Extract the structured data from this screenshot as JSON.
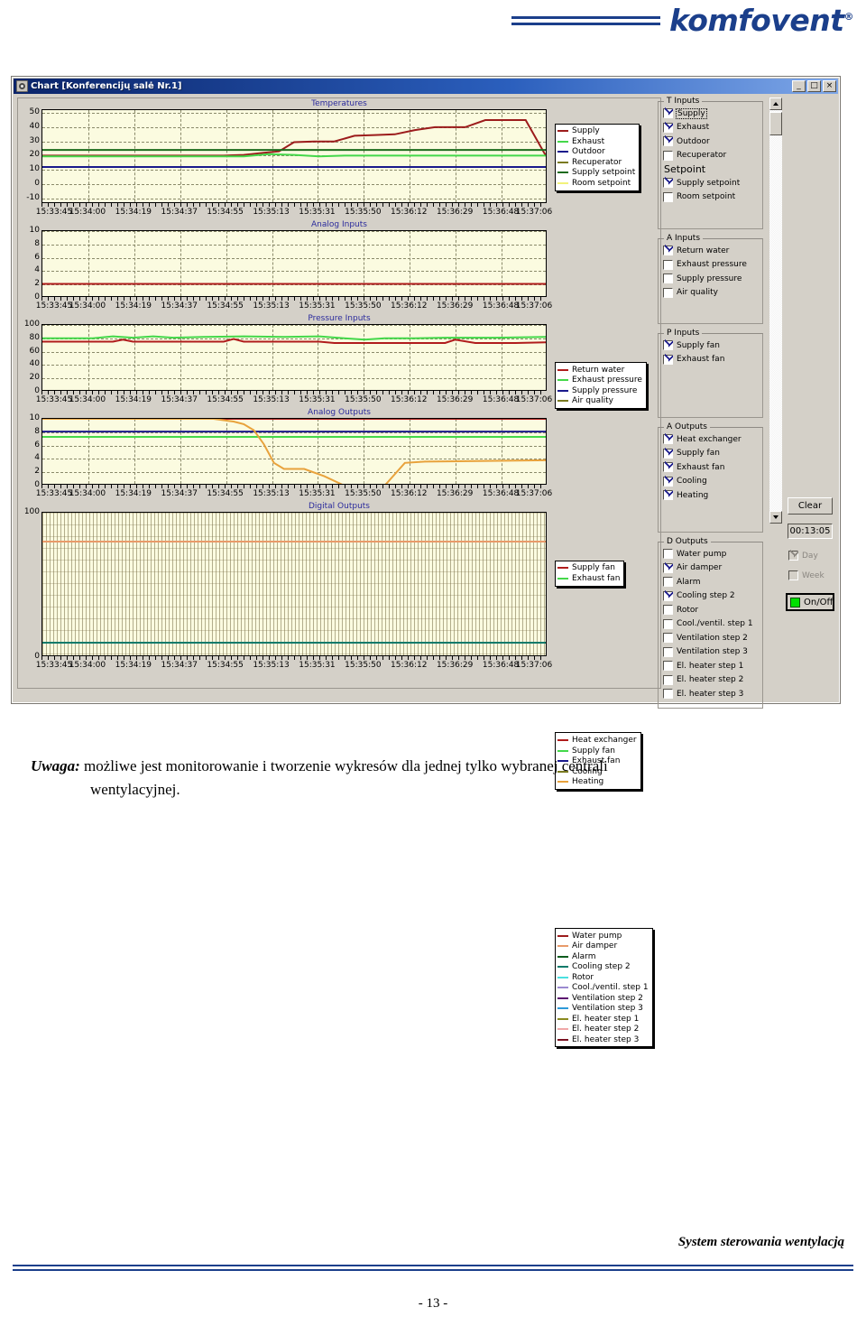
{
  "brand": {
    "name": "komfovent",
    "registered": "®"
  },
  "window": {
    "title": "Chart [Konferencijų salė Nr.1]",
    "minimize_label": "_",
    "maximize_label": "□",
    "close_label": "×"
  },
  "xaxis_labels": [
    "15:33:45",
    "15:34:00",
    "15:34:19",
    "15:34:37",
    "15:34:55",
    "15:35:13",
    "15:35:31",
    "15:35:50",
    "15:36:12",
    "15:36:29",
    "15:36:48",
    "15:37:06"
  ],
  "charts": [
    {
      "title": "Temperatures",
      "yticks": [
        "50",
        "40",
        "30",
        "20",
        "10",
        "0",
        "-10"
      ],
      "legend": [
        {
          "label": "Supply",
          "color": "#9c1c1c"
        },
        {
          "label": "Exhaust",
          "color": "#44d84a"
        },
        {
          "label": "Outdoor",
          "color": "#1a1a8c"
        },
        {
          "label": "Recuperator",
          "color": "#7a7a20"
        },
        {
          "label": "Supply setpoint",
          "color": "#1d6b1d"
        },
        {
          "label": "Room setpoint",
          "color": "#f2f27a"
        }
      ]
    },
    {
      "title": "Analog Inputs",
      "yticks": [
        "10",
        "8",
        "6",
        "4",
        "2",
        "0"
      ],
      "legend": [
        {
          "label": "Return water",
          "color": "#b01c1c"
        },
        {
          "label": "Exhaust pressure",
          "color": "#44d84a"
        },
        {
          "label": "Supply pressure",
          "color": "#1a1a8c"
        },
        {
          "label": "Air quality",
          "color": "#7a7a20"
        }
      ]
    },
    {
      "title": "Pressure Inputs",
      "yticks": [
        "100",
        "80",
        "60",
        "40",
        "20",
        "0"
      ],
      "legend": [
        {
          "label": "Supply fan",
          "color": "#b01c1c"
        },
        {
          "label": "Exhaust fan",
          "color": "#44d84a"
        }
      ]
    },
    {
      "title": "Analog Outputs",
      "yticks": [
        "10",
        "8",
        "6",
        "4",
        "2",
        "0"
      ],
      "legend": [
        {
          "label": "Heat exchanger",
          "color": "#b01c1c"
        },
        {
          "label": "Supply fan",
          "color": "#44d84a"
        },
        {
          "label": "Exhaust fan",
          "color": "#1a1a8c"
        },
        {
          "label": "Cooling",
          "color": "#7a7a20"
        },
        {
          "label": "Heating",
          "color": "#e8a23c"
        }
      ]
    },
    {
      "title": "Digital Outputs",
      "yticks": [
        "100",
        "0"
      ],
      "legend": [
        {
          "label": "Water pump",
          "color": "#9c1c1c"
        },
        {
          "label": "Air damper",
          "color": "#e89a6a"
        },
        {
          "label": "Alarm",
          "color": "#0d5c1e"
        },
        {
          "label": "Cooling step 2",
          "color": "#0d7a6a"
        },
        {
          "label": "Rotor",
          "color": "#4ae0e0"
        },
        {
          "label": "Cool./ventil. step 1",
          "color": "#9a8ad0"
        },
        {
          "label": "Ventilation step 2",
          "color": "#5c1070"
        },
        {
          "label": "Ventilation step 3",
          "color": "#2e9ad8"
        },
        {
          "label": "El. heater step 1",
          "color": "#8a8a20"
        },
        {
          "label": "El. heater step 2",
          "color": "#f0a8a8"
        },
        {
          "label": "El. heater step 3",
          "color": "#7a1020"
        }
      ]
    }
  ],
  "chart_data": {
    "type": "line",
    "title": "Chart [Konferencijų salė Nr.1]",
    "xlabel": "",
    "x_ticks": [
      "15:33:45",
      "15:34:00",
      "15:34:19",
      "15:34:37",
      "15:34:55",
      "15:35:13",
      "15:35:31",
      "15:35:50",
      "15:36:12",
      "15:36:29",
      "15:36:48",
      "15:37:06"
    ],
    "grid": true,
    "legend_position": "right",
    "panels": [
      {
        "title": "Temperatures",
        "ylabel": "",
        "ylim": [
          -14,
          52
        ],
        "yticks": [
          50,
          40,
          30,
          20,
          10,
          0,
          -10
        ],
        "series": [
          {
            "name": "Supply",
            "color": "#9c1c1c",
            "x": [
              0,
              18,
              36,
              40,
              44,
              47,
              50,
              54,
              58,
              62,
              66,
              70,
              74,
              78,
              84,
              88,
              92,
              96,
              100
            ],
            "values": [
              20,
              20,
              20,
              20.5,
              22,
              23,
              29.5,
              30,
              30,
              34,
              34.5,
              35,
              38,
              40,
              40,
              45,
              45,
              45,
              20
            ]
          },
          {
            "name": "Exhaust",
            "color": "#44d84a",
            "x": [
              0,
              40,
              45,
              50,
              55,
              60,
              100
            ],
            "values": [
              19.5,
              19.5,
              21,
              20.5,
              19.5,
              20,
              20
            ]
          },
          {
            "name": "Outdoor",
            "color": "#1a1a8c",
            "x": [
              0,
              100
            ],
            "values": [
              12,
              12
            ]
          },
          {
            "name": "Recuperator",
            "color": "#7a7a20",
            "x": [],
            "values": []
          },
          {
            "name": "Supply setpoint",
            "color": "#1d6b1d",
            "x": [
              0,
              100
            ],
            "values": [
              24,
              24
            ]
          },
          {
            "name": "Room setpoint",
            "color": "#f2f27a",
            "x": [],
            "values": []
          }
        ]
      },
      {
        "title": "Analog Inputs",
        "ylim": [
          0,
          10
        ],
        "yticks": [
          10,
          8,
          6,
          4,
          2,
          0
        ],
        "series": [
          {
            "name": "Return water",
            "color": "#b01c1c",
            "x": [
              0,
              100
            ],
            "values": [
              2.1,
              2.1
            ]
          },
          {
            "name": "Exhaust pressure",
            "color": "#44d84a",
            "x": [],
            "values": []
          },
          {
            "name": "Supply pressure",
            "color": "#1a1a8c",
            "x": [],
            "values": []
          },
          {
            "name": "Air quality",
            "color": "#7a7a20",
            "x": [],
            "values": []
          }
        ]
      },
      {
        "title": "Pressure Inputs",
        "ylim": [
          0,
          100
        ],
        "yticks": [
          100,
          80,
          60,
          40,
          20,
          0
        ],
        "series": [
          {
            "name": "Supply fan",
            "color": "#b01c1c",
            "x": [
              0,
              14,
              16,
              18,
              36,
              38,
              40,
              55,
              58,
              70,
              80,
              82,
              86,
              94,
              100
            ],
            "values": [
              75,
              75,
              78,
              75,
              75,
              79,
              75,
              75,
              73,
              73,
              73,
              78,
              73,
              73,
              74
            ]
          },
          {
            "name": "Exhaust fan",
            "color": "#44d84a",
            "x": [
              0,
              10,
              14,
              18,
              22,
              26,
              32,
              40,
              48,
              55,
              60,
              64,
              68,
              74,
              80,
              90,
              100
            ],
            "values": [
              80,
              80,
              83,
              81,
              83,
              81,
              82,
              83,
              82,
              83,
              80,
              78,
              80,
              80,
              81,
              81,
              82
            ]
          }
        ]
      },
      {
        "title": "Analog Outputs",
        "ylim": [
          0,
          10
        ],
        "yticks": [
          10,
          8,
          6,
          4,
          2,
          0
        ],
        "series": [
          {
            "name": "Heat exchanger",
            "color": "#b01c1c",
            "x": [
              0,
              100
            ],
            "values": [
              10,
              10
            ]
          },
          {
            "name": "Supply fan",
            "color": "#44d84a",
            "x": [
              0,
              100
            ],
            "values": [
              7.3,
              7.3
            ]
          },
          {
            "name": "Exhaust fan",
            "color": "#1a1a8c",
            "x": [
              0,
              100
            ],
            "values": [
              8.1,
              8.1
            ]
          },
          {
            "name": "Cooling",
            "color": "#7a7a20",
            "x": [
              0,
              100
            ],
            "values": [
              0,
              0
            ]
          },
          {
            "name": "Heating",
            "color": "#e8a23c",
            "x": [
              0,
              30,
              34,
              38,
              40,
              42,
              44,
              46,
              48,
              52,
              56,
              60,
              64,
              68,
              72,
              76,
              100
            ],
            "values": [
              10,
              10,
              10,
              9.6,
              9.2,
              8.3,
              6.2,
              3.4,
              2.5,
              2.5,
              1.4,
              0,
              0,
              0,
              3.4,
              3.6,
              3.8
            ]
          }
        ]
      },
      {
        "title": "Digital Outputs",
        "ylim": [
          0,
          100
        ],
        "yticks": [
          100,
          0
        ],
        "series": [
          {
            "name": "Water pump",
            "color": "#9c1c1c",
            "x": [],
            "values": []
          },
          {
            "name": "Air damper",
            "color": "#e89a6a",
            "x": [
              0,
              100
            ],
            "values": [
              80,
              80
            ]
          },
          {
            "name": "Alarm",
            "color": "#0d5c1e",
            "x": [],
            "values": []
          },
          {
            "name": "Cooling step 2",
            "color": "#0d7a6a",
            "x": [
              0,
              100
            ],
            "values": [
              10,
              10
            ]
          },
          {
            "name": "Rotor",
            "color": "#4ae0e0",
            "x": [],
            "values": []
          },
          {
            "name": "Cool./ventil. step 1",
            "color": "#9a8ad0",
            "x": [],
            "values": []
          },
          {
            "name": "Ventilation step 2",
            "color": "#5c1070",
            "x": [],
            "values": []
          },
          {
            "name": "Ventilation step 3",
            "color": "#2e9ad8",
            "x": [],
            "values": []
          },
          {
            "name": "El. heater step 1",
            "color": "#8a8a20",
            "x": [],
            "values": []
          },
          {
            "name": "El. heater step 2",
            "color": "#f0a8a8",
            "x": [],
            "values": []
          },
          {
            "name": "El. heater step 3",
            "color": "#7a1020",
            "x": [],
            "values": []
          }
        ]
      }
    ]
  },
  "sidebar": {
    "groups": [
      {
        "title": "T Inputs",
        "items": [
          {
            "label": "Supply",
            "checked": true,
            "focused": true
          },
          {
            "label": "Exhaust",
            "checked": true
          },
          {
            "label": "Outdoor",
            "checked": true
          },
          {
            "label": "Recuperator",
            "checked": false
          }
        ],
        "subhead": "Setpoint",
        "items2": [
          {
            "label": "Supply setpoint",
            "checked": true
          },
          {
            "label": "Room setpoint",
            "checked": false
          }
        ]
      },
      {
        "title": "A Inputs",
        "items": [
          {
            "label": "Return water",
            "checked": true
          },
          {
            "label": "Exhaust pressure",
            "checked": false
          },
          {
            "label": "Supply pressure",
            "checked": false
          },
          {
            "label": "Air quality",
            "checked": false
          }
        ]
      },
      {
        "title": "P Inputs",
        "items": [
          {
            "label": "Supply fan",
            "checked": true
          },
          {
            "label": "Exhaust fan",
            "checked": true
          }
        ]
      },
      {
        "title": "A Outputs",
        "items": [
          {
            "label": "Heat exchanger",
            "checked": true
          },
          {
            "label": "Supply fan",
            "checked": true
          },
          {
            "label": "Exhaust fan",
            "checked": true
          },
          {
            "label": "Cooling",
            "checked": true
          },
          {
            "label": "Heating",
            "checked": true
          }
        ]
      },
      {
        "title": "D Outputs",
        "items": [
          {
            "label": "Water pump",
            "checked": false
          },
          {
            "label": "Air damper",
            "checked": true
          },
          {
            "label": "Alarm",
            "checked": false
          },
          {
            "label": "Cooling step 2",
            "checked": true
          },
          {
            "label": "Rotor",
            "checked": false
          },
          {
            "label": "Cool./ventil. step 1",
            "checked": false
          },
          {
            "label": "Ventilation step 2",
            "checked": false
          },
          {
            "label": "Ventilation step 3",
            "checked": false
          },
          {
            "label": "El. heater step 1",
            "checked": false
          },
          {
            "label": "El. heater step 2",
            "checked": false
          },
          {
            "label": "El. heater step 3",
            "checked": false
          }
        ]
      }
    ]
  },
  "controls": {
    "clear_label": "Clear",
    "timer_value": "00:13:05",
    "day_label": "Day",
    "day_checked": true,
    "week_label": "Week",
    "week_checked": false,
    "onoff_label": "On/Off",
    "onoff_color": "#00e000"
  },
  "note": {
    "lead": "Uwaga:",
    "line1": "możliwe jest monitorowanie i tworzenie wykresów dla jednej tylko wybranej centrali",
    "line2": "wentylacyjnej."
  },
  "footer": {
    "text": "System sterowania wentylacją",
    "page": "- 13 -"
  }
}
